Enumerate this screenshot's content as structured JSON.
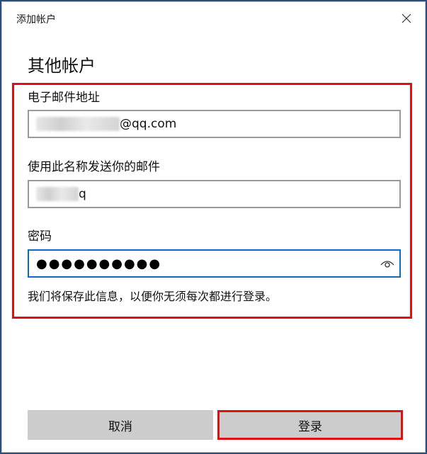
{
  "window": {
    "title": "添加帐户"
  },
  "heading": "其他帐户",
  "email": {
    "label": "电子邮件地址",
    "value_suffix": "@qq.com"
  },
  "display_name": {
    "label": "使用此名称发送你的邮件",
    "value_tail": "q"
  },
  "password": {
    "label": "密码",
    "masked_value": "●●●●●●●●●●",
    "reveal_icon": "eye-icon"
  },
  "info_text": "我们将保存此信息，以便你无须每次都进行登录。",
  "buttons": {
    "cancel": "取消",
    "login": "登录"
  },
  "colors": {
    "highlight": "#e01010",
    "focus_border": "#0a6cc4",
    "button_bg": "#cccccc"
  }
}
